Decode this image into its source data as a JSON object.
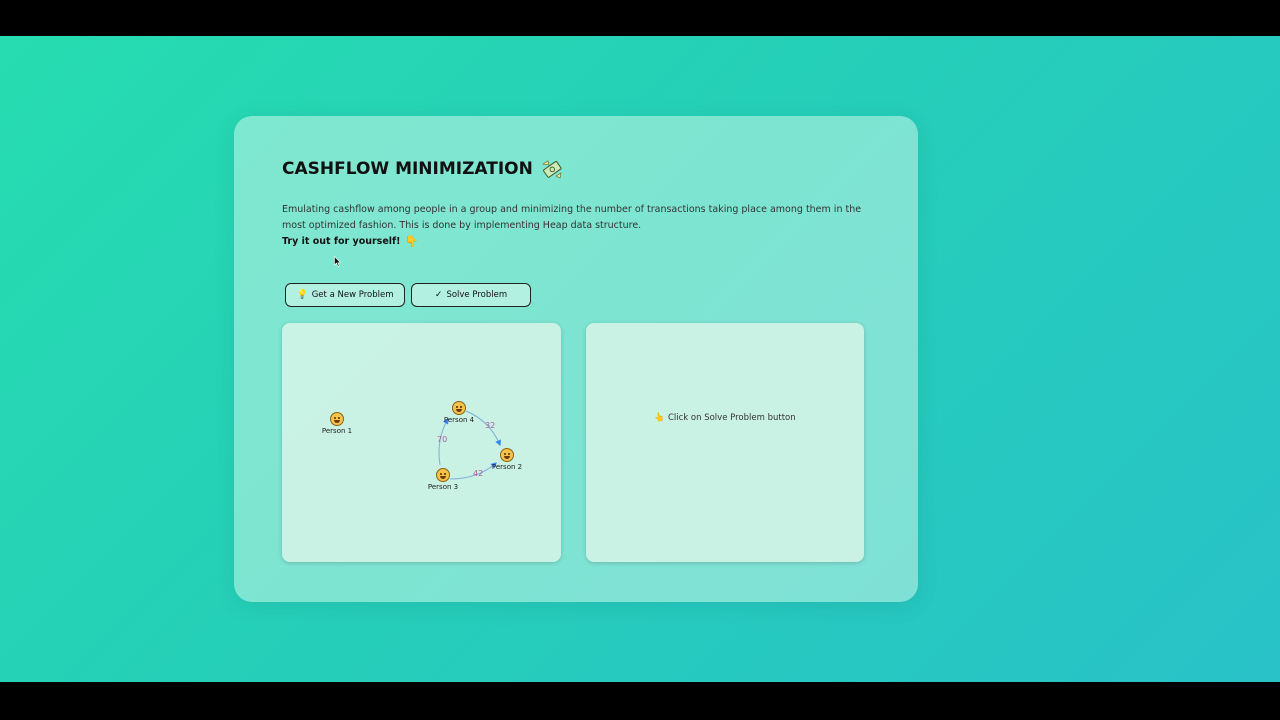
{
  "app": {
    "title": "CASHFLOW MINIMIZATION",
    "title_icon": "money-with-wings-icon",
    "description": "Emulating cashflow among people in a group and minimizing the number of transactions taking place among them in the most optimized fashion. This is done by implementing Heap data structure.",
    "try_text": "Try it out for yourself!",
    "try_icon": "pointing-down-hand-icon"
  },
  "toolbar": {
    "new_problem_label": "Get a New Problem",
    "new_problem_icon": "light-bulb-icon",
    "solve_label": "Solve Problem",
    "solve_icon": "check-mark-icon"
  },
  "graph": {
    "nodes": [
      {
        "id": "p1",
        "label": "Person 1"
      },
      {
        "id": "p2",
        "label": "Person 2"
      },
      {
        "id": "p3",
        "label": "Person 3"
      },
      {
        "id": "p4",
        "label": "Person 4"
      }
    ],
    "edges": [
      {
        "from": "Person 4",
        "to": "Person 2",
        "amount": "32"
      },
      {
        "from": "Person 3",
        "to": "Person 4",
        "amount": "70"
      },
      {
        "from": "Person 3",
        "to": "Person 2",
        "amount": "42"
      }
    ]
  },
  "solution_panel": {
    "placeholder": "Click on Solve Problem button",
    "placeholder_icon": "pointing-hand-icon"
  },
  "colors": {
    "background_start": "#27dcb0",
    "background_end": "#28c2c8",
    "edge": "#3b82f6",
    "edge_label": "#a8609a"
  }
}
